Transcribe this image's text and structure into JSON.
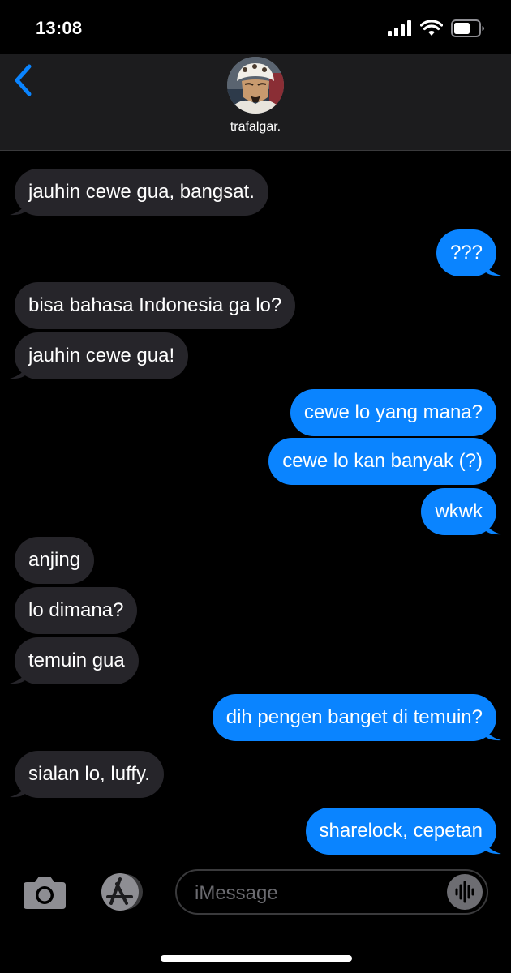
{
  "status_bar": {
    "time": "13:08",
    "icons": [
      "cellular-signal-icon",
      "wifi-icon",
      "battery-icon"
    ]
  },
  "header": {
    "back_icon": "chevron-left-icon",
    "contact_name": "trafalgar."
  },
  "messages": [
    {
      "direction": "in",
      "text": "jauhin cewe gua, bangsat.",
      "tail": true
    },
    {
      "direction": "out",
      "text": "???",
      "tail": true
    },
    {
      "direction": "in",
      "text": "bisa bahasa Indonesia ga lo?",
      "tail": false
    },
    {
      "direction": "in",
      "text": "jauhin cewe gua!",
      "tail": true
    },
    {
      "direction": "out",
      "text": "cewe lo yang mana?",
      "tail": false
    },
    {
      "direction": "out",
      "text": "cewe lo kan banyak (?)",
      "tail": false
    },
    {
      "direction": "out",
      "text": "wkwk",
      "tail": true
    },
    {
      "direction": "in",
      "text": "anjing",
      "tail": false
    },
    {
      "direction": "in",
      "text": "lo dimana?",
      "tail": false
    },
    {
      "direction": "in",
      "text": "temuin gua",
      "tail": true
    },
    {
      "direction": "out",
      "text": "dih pengen banget di temuin?",
      "tail": true
    },
    {
      "direction": "in",
      "text": "sialan lo, luffy.",
      "tail": true
    },
    {
      "direction": "out",
      "text": "sharelock, cepetan",
      "tail": true
    }
  ],
  "input_bar": {
    "camera_icon": "camera-icon",
    "apps_icon": "app-store-icon",
    "placeholder": "iMessage",
    "value": "",
    "audio_icon": "audio-waveform-icon"
  },
  "colors": {
    "background": "#000000",
    "header": "#1c1c1e",
    "incoming_bubble": "#26252a",
    "outgoing_bubble": "#0a84ff",
    "accent": "#0a84ff"
  }
}
